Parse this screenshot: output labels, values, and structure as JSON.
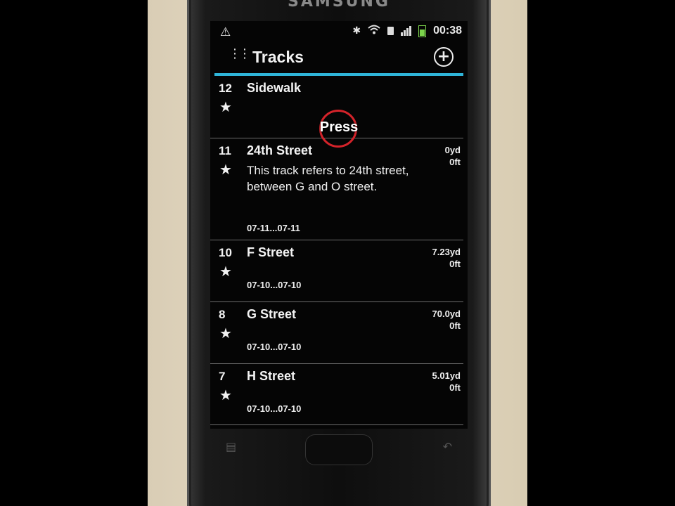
{
  "device": {
    "brand": "SAMSUNG"
  },
  "status_bar": {
    "time": "00:38",
    "icons": [
      "warning-icon",
      "bluetooth-icon",
      "wifi-icon",
      "sdcard-icon",
      "signal-icon",
      "battery-icon"
    ]
  },
  "app_bar": {
    "title": "Tracks",
    "app_icon": "paw-prints-icon",
    "add_icon": "add-circle-icon"
  },
  "colors": {
    "accent": "#2fb5d9",
    "press_circle": "#d4232a",
    "battery": "#7bd44b"
  },
  "overlay": {
    "press_label": "Press"
  },
  "tracks": [
    {
      "number": "12",
      "name": "Sidewalk",
      "description": "",
      "dates": "",
      "distance": "",
      "elevation": ""
    },
    {
      "number": "11",
      "name": "24th Street",
      "description": "This track refers to 24th street, between G and O street.",
      "dates": "07-11...07-11",
      "distance": "0yd",
      "elevation": "0ft"
    },
    {
      "number": "10",
      "name": "F Street",
      "description": "",
      "dates": "07-10...07-10",
      "distance": "7.23yd",
      "elevation": "0ft"
    },
    {
      "number": "8",
      "name": "G Street",
      "description": "",
      "dates": "07-10...07-10",
      "distance": "70.0yd",
      "elevation": "0ft"
    },
    {
      "number": "7",
      "name": "H Street",
      "description": "",
      "dates": "07-10...07-10",
      "distance": "5.01yd",
      "elevation": "0ft"
    }
  ]
}
